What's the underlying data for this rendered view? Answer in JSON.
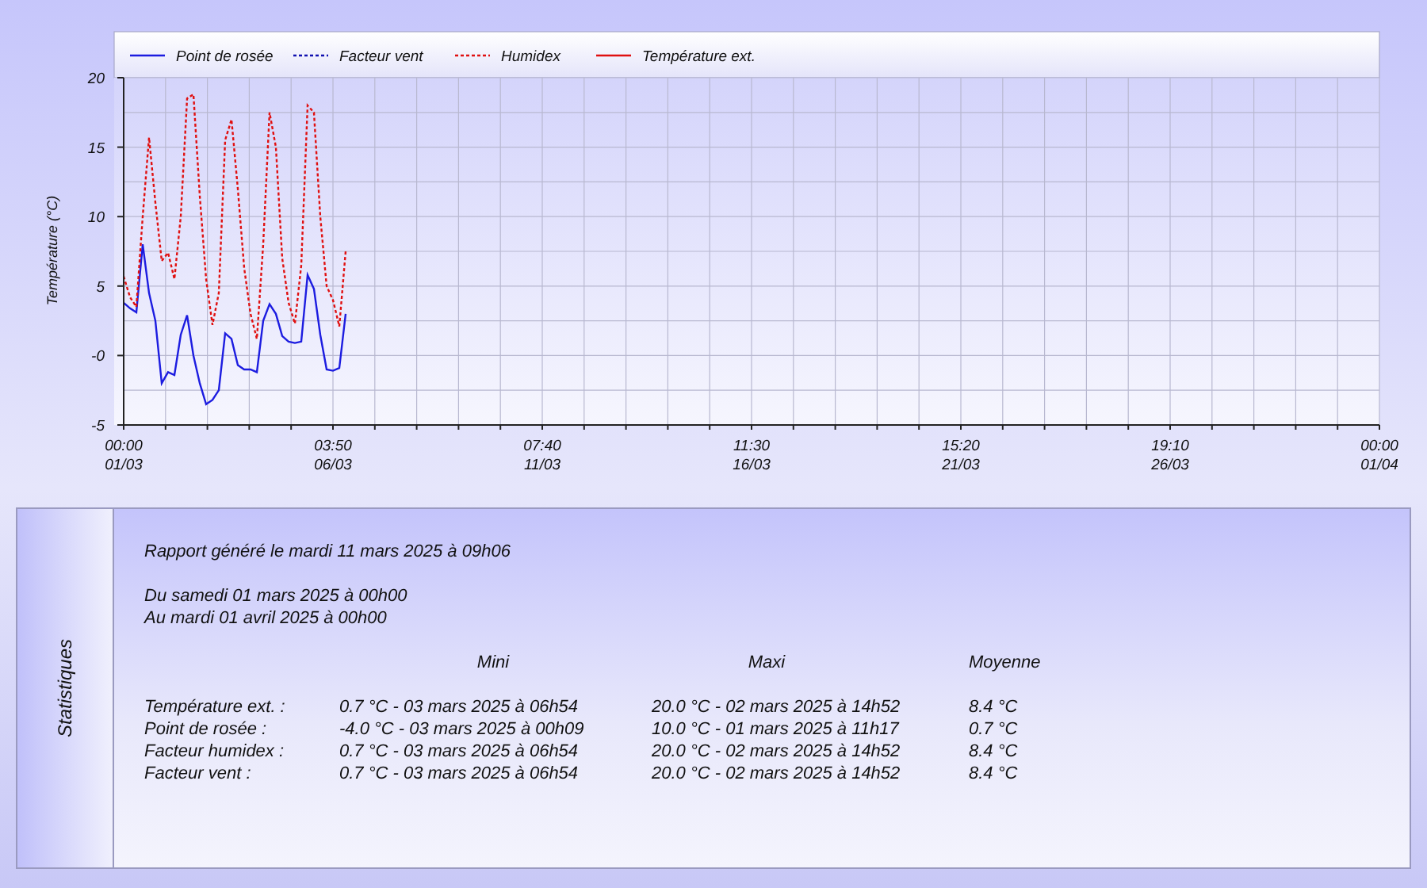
{
  "chart": {
    "chart_data": {
      "type": "line",
      "ylabel": "Température (°C)",
      "categories": [
        "00:00 01/03",
        null,
        null,
        null,
        null,
        null,
        null,
        null,
        null,
        null,
        null,
        null,
        null,
        null,
        null,
        null,
        null,
        null,
        null,
        null,
        null,
        null,
        null,
        null,
        null,
        null,
        null,
        null,
        null,
        null,
        null,
        null,
        null,
        "03:50 06/03",
        null,
        null,
        null,
        null,
        null,
        null,
        null,
        null,
        null,
        null,
        null,
        null,
        null,
        null,
        null,
        null,
        null,
        null,
        null,
        null,
        null,
        null,
        null,
        null,
        null,
        null,
        null,
        null,
        null,
        null,
        null,
        null,
        "07:40 11/03",
        null,
        null,
        null,
        null,
        null,
        null,
        null,
        null,
        null,
        null,
        null,
        null,
        null,
        null,
        null,
        null,
        null,
        null,
        null,
        null,
        null,
        null,
        null,
        null,
        null,
        null,
        null,
        null,
        null,
        null,
        null,
        null,
        "11:30 16/03",
        null,
        null,
        null,
        null,
        null,
        null,
        null,
        null,
        null,
        null,
        null,
        null,
        null,
        null,
        null,
        null,
        null,
        null,
        null,
        null,
        null,
        null,
        null,
        null,
        null,
        null,
        null,
        null,
        null,
        null,
        null,
        null,
        "15:20 21/03",
        null,
        null,
        null,
        null,
        null,
        null,
        null,
        null,
        null,
        null,
        null,
        null,
        null,
        null,
        null,
        null,
        null,
        null,
        null,
        null,
        null,
        null,
        null,
        null,
        null,
        null,
        null,
        null,
        null,
        null,
        null,
        null,
        "19:10 26/03",
        null,
        null,
        null,
        null,
        null,
        null,
        null,
        null,
        null,
        null,
        null,
        null,
        null,
        null,
        null,
        null,
        null,
        null,
        null,
        null,
        null,
        null,
        null,
        null,
        null,
        null,
        null,
        null,
        null,
        null,
        null,
        null,
        "00:00 01/04"
      ],
      "series": [
        {
          "name": "Point de rosée",
          "color": "#1c1ce0",
          "line_style": "solid",
          "values": [
            3.8,
            3.4,
            3.1,
            8.0,
            4.5,
            2.5,
            -2.0,
            -1.2,
            -1.4,
            1.5,
            2.9,
            0.0,
            -2.0,
            -3.5,
            -3.2,
            -2.5,
            1.6,
            1.2,
            -0.7,
            -1.0,
            -1.0,
            -1.2,
            2.5,
            3.7,
            3.0,
            1.4,
            1.0,
            0.9,
            1.0,
            5.8,
            4.8,
            1.5,
            -1.0,
            -1.1,
            -0.9,
            3.0,
            null,
            null,
            null,
            null,
            null,
            null,
            null,
            null,
            null,
            null,
            null,
            null,
            null,
            null,
            null,
            null,
            null,
            null,
            null,
            null,
            null,
            null,
            null,
            null,
            null,
            null,
            null,
            null,
            null,
            null,
            null,
            null,
            null,
            null,
            null,
            null,
            null,
            null,
            null,
            null,
            null,
            null,
            null,
            null,
            null,
            null,
            null,
            null,
            null,
            null,
            null,
            null,
            null,
            null,
            null,
            null,
            null,
            null,
            null,
            null,
            null,
            null,
            null,
            null,
            null,
            null,
            null,
            null,
            null,
            null,
            null,
            null,
            null,
            null,
            null,
            null,
            null,
            null,
            null,
            null,
            null,
            null,
            null,
            null,
            null,
            null,
            null,
            null,
            null,
            null,
            null,
            null,
            null,
            null,
            null,
            null,
            null,
            null,
            null,
            null,
            null,
            null,
            null,
            null,
            null,
            null,
            null,
            null,
            null,
            null,
            null,
            null,
            null,
            null,
            null,
            null,
            null,
            null,
            null,
            null,
            null,
            null,
            null,
            null,
            null,
            null,
            null,
            null,
            null,
            null,
            null,
            null,
            null,
            null,
            null,
            null,
            null,
            null,
            null,
            null,
            null,
            null,
            null,
            null,
            null,
            null,
            null,
            null,
            null,
            null,
            null,
            null,
            null,
            null,
            null,
            null,
            null,
            null,
            null,
            null,
            null,
            null,
            null
          ]
        },
        {
          "name": "Facteur vent",
          "color": "#1010b0",
          "line_style": "dotted",
          "values": [
            null,
            null,
            null,
            null,
            null,
            null,
            null,
            null,
            null,
            null,
            null,
            null,
            null,
            null,
            null,
            null,
            null,
            null,
            null,
            null,
            null,
            null,
            null,
            null,
            null,
            null,
            null,
            null,
            null,
            null,
            null,
            null,
            null,
            null,
            null,
            null,
            null,
            null,
            null,
            null,
            null,
            null,
            null,
            null,
            null,
            null,
            null,
            null,
            null,
            null,
            null,
            null,
            null,
            null,
            null,
            null,
            null,
            null,
            null,
            null,
            null,
            null,
            null,
            null,
            null,
            null,
            null,
            null,
            null,
            null,
            null,
            null,
            null,
            null,
            null,
            null,
            null,
            null,
            null,
            null,
            null,
            null,
            null,
            null,
            null,
            null,
            null,
            null,
            null,
            null,
            null,
            null,
            null,
            null,
            null,
            null,
            null,
            null,
            null,
            null,
            null,
            null,
            null,
            null,
            null,
            null,
            null,
            null,
            null,
            null,
            null,
            null,
            null,
            null,
            null,
            null,
            null,
            null,
            null,
            null,
            null,
            null,
            null,
            null,
            null,
            null,
            null,
            null,
            null,
            null,
            null,
            null,
            null,
            null,
            null,
            null,
            null,
            null,
            null,
            null,
            null,
            null,
            null,
            null,
            null,
            null,
            null,
            null,
            null,
            null,
            null,
            null,
            null,
            null,
            null,
            null,
            null,
            null,
            null,
            null,
            null,
            null,
            null,
            null,
            null,
            null,
            null,
            null,
            null,
            null,
            null,
            null,
            null,
            null,
            null,
            null,
            null,
            null,
            null,
            null,
            null,
            null,
            null,
            null,
            null,
            null,
            null,
            null,
            null,
            null,
            null,
            null,
            null,
            null,
            null,
            null,
            null,
            null,
            null
          ]
        },
        {
          "name": "Humidex",
          "color": "#e01010",
          "line_style": "dotted",
          "values": [
            5.7,
            4.2,
            3.5,
            10.0,
            15.7,
            11.0,
            6.8,
            7.4,
            5.5,
            10.0,
            18.5,
            18.8,
            11.5,
            5.5,
            2.2,
            4.5,
            15.5,
            17.0,
            12.0,
            6.3,
            3.0,
            1.2,
            8.0,
            17.5,
            15.0,
            7.0,
            3.8,
            2.3,
            6.5,
            18.0,
            17.5,
            10.0,
            5.0,
            4.0,
            2.1,
            7.5,
            null,
            null,
            null,
            null,
            null,
            null,
            null,
            null,
            null,
            null,
            null,
            null,
            null,
            null,
            null,
            null,
            null,
            null,
            null,
            null,
            null,
            null,
            null,
            null,
            null,
            null,
            null,
            null,
            null,
            null,
            null,
            null,
            null,
            null,
            null,
            null,
            null,
            null,
            null,
            null,
            null,
            null,
            null,
            null,
            null,
            null,
            null,
            null,
            null,
            null,
            null,
            null,
            null,
            null,
            null,
            null,
            null,
            null,
            null,
            null,
            null,
            null,
            null,
            null,
            null,
            null,
            null,
            null,
            null,
            null,
            null,
            null,
            null,
            null,
            null,
            null,
            null,
            null,
            null,
            null,
            null,
            null,
            null,
            null,
            null,
            null,
            null,
            null,
            null,
            null,
            null,
            null,
            null,
            null,
            null,
            null,
            null,
            null,
            null,
            null,
            null,
            null,
            null,
            null,
            null,
            null,
            null,
            null,
            null,
            null,
            null,
            null,
            null,
            null,
            null,
            null,
            null,
            null,
            null,
            null,
            null,
            null,
            null,
            null,
            null,
            null,
            null,
            null,
            null,
            null,
            null,
            null,
            null,
            null,
            null,
            null,
            null,
            null,
            null,
            null,
            null,
            null,
            null,
            null,
            null,
            null,
            null,
            null,
            null,
            null,
            null,
            null,
            null,
            null,
            null,
            null,
            null,
            null,
            null,
            null,
            null,
            null,
            null
          ]
        },
        {
          "name": "Température ext.",
          "color": "#e01010",
          "line_style": "solid",
          "values": [
            null,
            null,
            null,
            null,
            null,
            null,
            null,
            null,
            null,
            null,
            null,
            null,
            null,
            null,
            null,
            null,
            null,
            null,
            null,
            null,
            null,
            null,
            null,
            null,
            null,
            null,
            null,
            null,
            null,
            null,
            null,
            null,
            null,
            null,
            null,
            null,
            null,
            null,
            null,
            null,
            null,
            null,
            null,
            null,
            null,
            null,
            null,
            null,
            null,
            null,
            null,
            null,
            null,
            null,
            null,
            null,
            null,
            null,
            null,
            null,
            null,
            null,
            null,
            null,
            null,
            null,
            null,
            null,
            null,
            null,
            null,
            null,
            null,
            null,
            null,
            null,
            null,
            null,
            null,
            null,
            null,
            null,
            null,
            null,
            null,
            null,
            null,
            null,
            null,
            null,
            null,
            null,
            null,
            null,
            null,
            null,
            null,
            null,
            null,
            null,
            null,
            null,
            null,
            null,
            null,
            null,
            null,
            null,
            null,
            null,
            null,
            null,
            null,
            null,
            null,
            null,
            null,
            null,
            null,
            null,
            null,
            null,
            null,
            null,
            null,
            null,
            null,
            null,
            null,
            null,
            null,
            null,
            null,
            null,
            null,
            null,
            null,
            null,
            null,
            null,
            null,
            null,
            null,
            null,
            null,
            null,
            null,
            null,
            null,
            null,
            null,
            null,
            null,
            null,
            null,
            null,
            null,
            null,
            null,
            null,
            null,
            null,
            null,
            null,
            null,
            null,
            null,
            null,
            null,
            null,
            null,
            null,
            null,
            null,
            null,
            null,
            null,
            null,
            null,
            null,
            null,
            null,
            null,
            null,
            null,
            null,
            null,
            null,
            null,
            null,
            null,
            null,
            null,
            null,
            null,
            null,
            null,
            null,
            null
          ]
        }
      ],
      "ylim": [
        -5,
        20
      ],
      "grid": true,
      "legend": true,
      "yticks": [
        {
          "value": 20,
          "label": "20"
        },
        {
          "value": 15,
          "label": "15"
        },
        {
          "value": 10,
          "label": "10"
        },
        {
          "value": 5,
          "label": "5"
        },
        {
          "value": 0,
          "label": "-0"
        },
        {
          "value": -5,
          "label": "-5"
        }
      ]
    }
  },
  "statistics": {
    "tab_label": "Statistiques",
    "report_line": "Rapport généré le mardi 11 mars 2025 à 09h06",
    "period_lines": [
      "Du samedi 01 mars 2025 à 00h00",
      "Au mardi 01 avril 2025 à 00h00"
    ],
    "columns": [
      "Mini",
      "Maxi",
      "Moyenne"
    ],
    "rows": [
      {
        "label": "Température ext. :",
        "mini": "0.7 °C - 03 mars 2025 à 06h54",
        "maxi": "20.0 °C - 02 mars 2025 à 14h52",
        "moyenne": "8.4 °C"
      },
      {
        "label": "Point de rosée :",
        "mini": "-4.0 °C - 03 mars 2025 à 00h09",
        "maxi": "10.0 °C - 01 mars 2025 à 11h17",
        "moyenne": "0.7 °C"
      },
      {
        "label": "Facteur humidex :",
        "mini": "0.7 °C - 03 mars 2025 à 06h54",
        "maxi": "20.0 °C - 02 mars 2025 à 14h52",
        "moyenne": "8.4 °C"
      },
      {
        "label": "Facteur vent :",
        "mini": "0.7 °C - 03 mars 2025 à 06h54",
        "maxi": "20.0 °C - 02 mars 2025 à 14h52",
        "moyenne": "8.4 °C"
      }
    ]
  }
}
